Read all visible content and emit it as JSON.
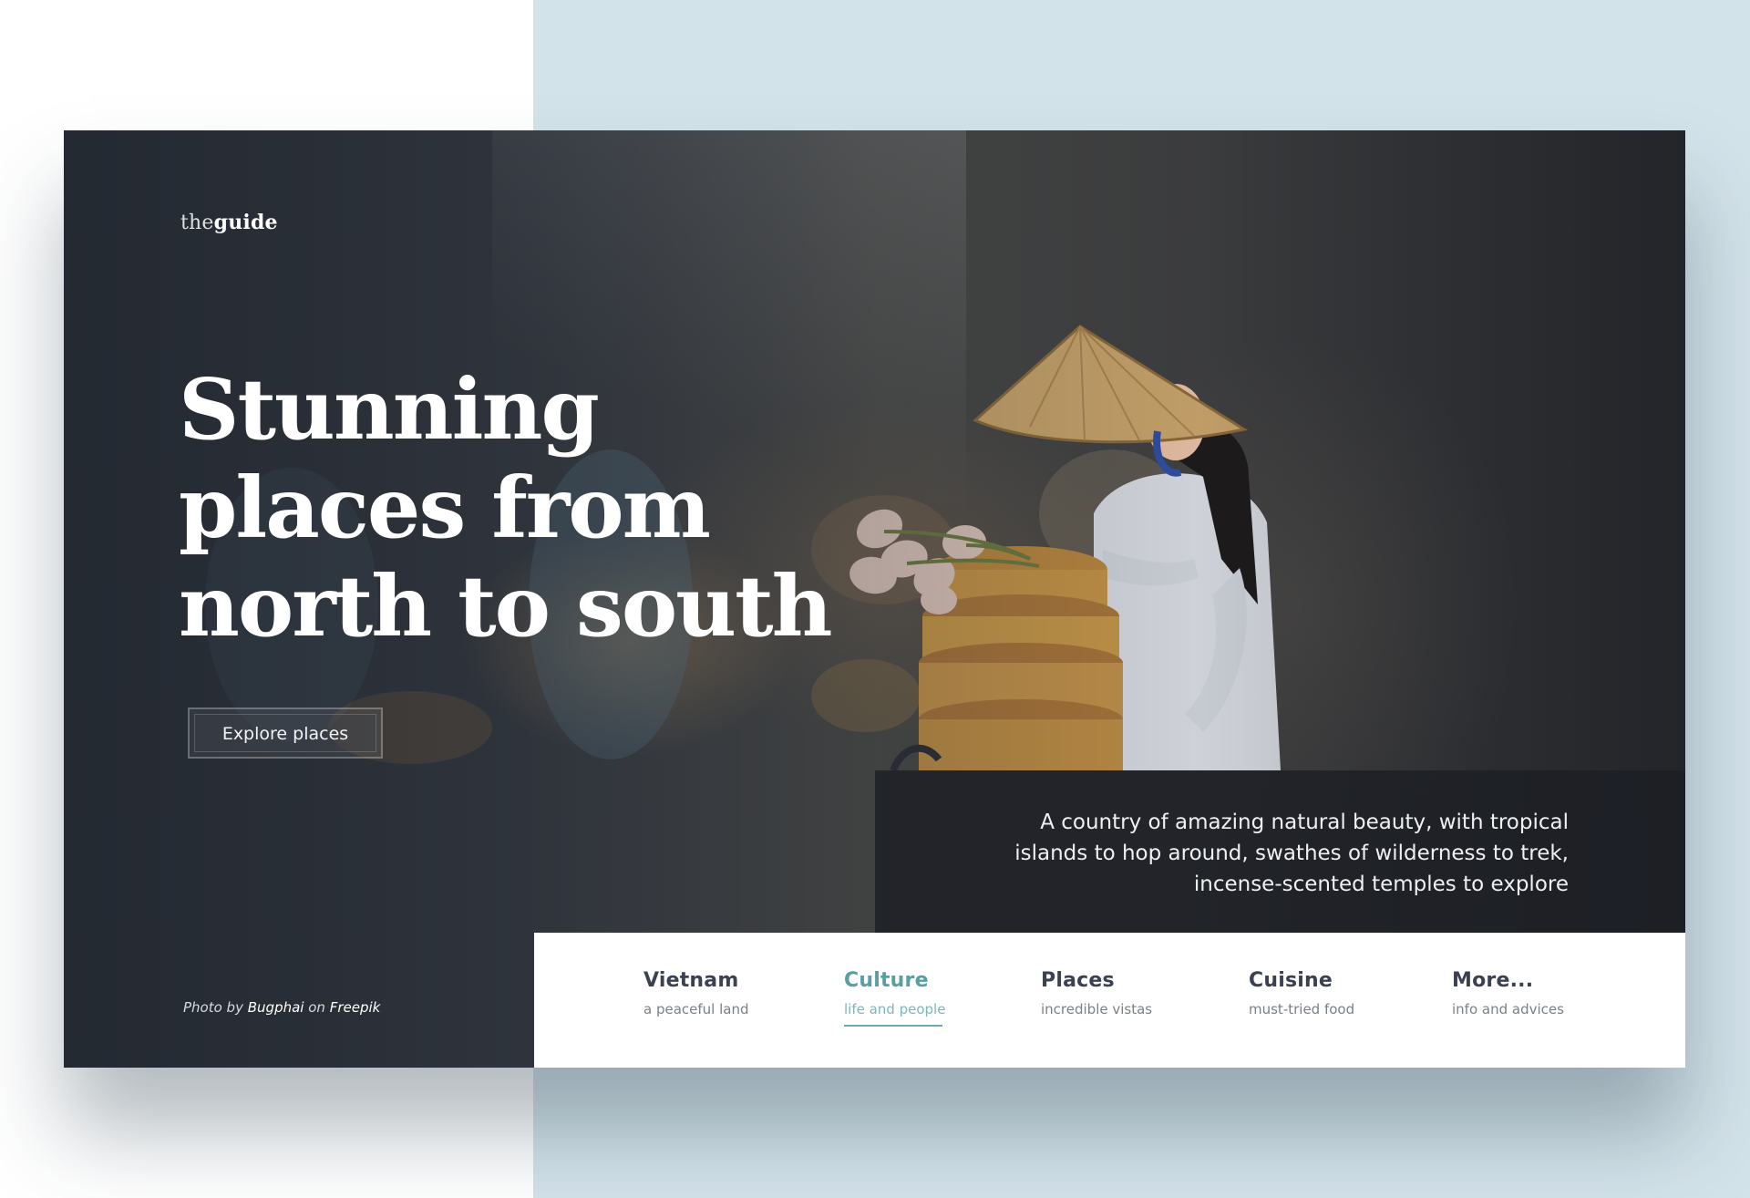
{
  "logo": {
    "part1": "the",
    "part2": "guide"
  },
  "hero": {
    "headline_lines": [
      "Stunning",
      "places from",
      "north to south"
    ],
    "cta_label": "Explore places",
    "description": "A country of amazing natural beauty, with tropical islands to hop around, swathes of wilderness to trek, incense-scented temples to explore"
  },
  "credit": {
    "prefix": "Photo by",
    "author": "Bugphai",
    "on": "on",
    "source": "Freepik"
  },
  "nav": {
    "items": [
      {
        "title": "Vietnam",
        "subtitle": "a peaceful land"
      },
      {
        "title": "Culture",
        "subtitle": "life and people",
        "active": true
      },
      {
        "title": "Places",
        "subtitle": "incredible vistas"
      },
      {
        "title": "Cuisine",
        "subtitle": "must-tried food"
      },
      {
        "title": "More...",
        "subtitle": "info and advices"
      }
    ]
  },
  "colors": {
    "page_left_bg": "#ffffff",
    "page_right_bg": "#d3e3ea",
    "accent": "#5a9ea4",
    "nav_text": "#3b4150",
    "description_bg": "#1c1e24"
  }
}
